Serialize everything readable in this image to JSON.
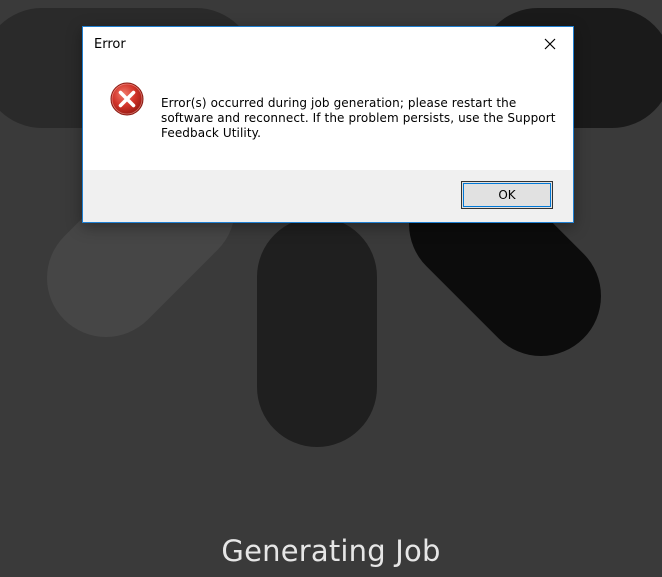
{
  "background": {
    "status_text": "Generating Job",
    "spinner_icon": "loading-spinner-icon"
  },
  "dialog": {
    "title": "Error",
    "close_icon": "close-icon",
    "error_icon": "error-icon",
    "message": "Error(s) occurred during job generation; please restart the software and reconnect. If the problem persists, use the Support Feedback Utility.",
    "ok_label": "OK"
  },
  "colors": {
    "background": "#3a3a3a",
    "dialog_border": "#1f7fd1",
    "error_red": "#c42b1c",
    "footer": "#f0f0f0"
  }
}
